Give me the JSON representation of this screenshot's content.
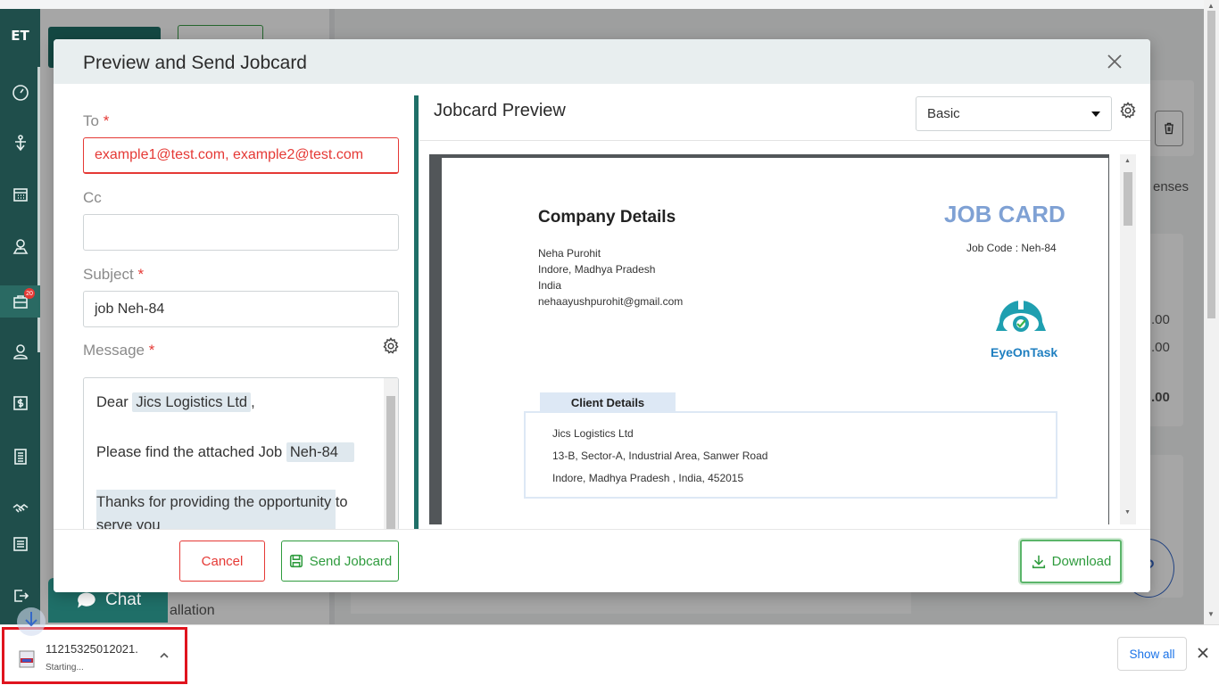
{
  "app": {
    "logo_text": "ET",
    "nav_badge_count": "20"
  },
  "background": {
    "chat_label": "Chat",
    "installation_partial": "allation",
    "expenses_partial": "enses",
    "amount_1": ".00",
    "amount_2": ".00",
    "amount_3": ".00",
    "help_label": "?"
  },
  "modal": {
    "title": "Preview and Send Jobcard",
    "form": {
      "to_label": "To",
      "to_placeholder": "example1@test.com, example2@test.com",
      "cc_label": "Cc",
      "cc_value": "",
      "subject_label": "Subject",
      "subject_value": "job Neh-84",
      "message_label": "Message",
      "required_mark": "*",
      "message": {
        "greeting": "Dear",
        "client_tag": "Jics Logistics Ltd",
        "greeting_suffix": ",",
        "line2_prefix": "Please find the attached Job",
        "job_tag": "Neh-84",
        "line3_a": "Thanks for providing the opportunity to",
        "line3_b": "serve you"
      }
    },
    "preview": {
      "title": "Jobcard Preview",
      "template_selected": "Basic",
      "document": {
        "company_title": "Company Details",
        "company_name": "Neha Purohit",
        "company_city": "Indore, Madhya Pradesh",
        "company_country": "India",
        "company_email": "nehaayushpurohit@gmail.com",
        "doc_title": "JOB CARD",
        "job_code": "Job Code : Neh-84",
        "logo_text": "EyeOnTask",
        "client_tab": "Client Details",
        "client_name": "Jics Logistics Ltd",
        "client_address": "13-B, Sector-A, Industrial Area, Sanwer Road",
        "client_city": "Indore, Madhya Pradesh , India, 452015"
      }
    },
    "buttons": {
      "cancel": "Cancel",
      "send": "Send Jobcard",
      "download": "Download"
    }
  },
  "download_shelf": {
    "file_name": "11215325012021.",
    "status": "Starting...",
    "show_all": "Show all"
  },
  "colors": {
    "nav_bg": "#1f4e4b",
    "accent_green": "#2e9b3d",
    "error_red": "#e53935",
    "jobcard_blue": "#7fa1d4"
  }
}
